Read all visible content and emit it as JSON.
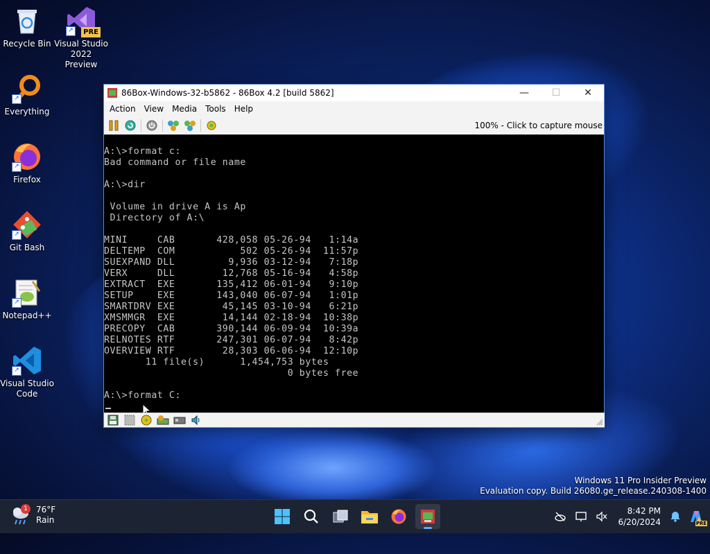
{
  "desktop": {
    "icons": [
      {
        "label": "Recycle Bin"
      },
      {
        "label": "Visual Studio 2022 Preview",
        "badge": "PRE"
      },
      {
        "label": "Everything"
      },
      {
        "label": "Firefox"
      },
      {
        "label": "Git Bash"
      },
      {
        "label": "Notepad++"
      },
      {
        "label": "Visual Studio Code"
      }
    ]
  },
  "window": {
    "title": "86Box-Windows-32-b5862 - 86Box 4.2 [build 5862]",
    "menu": [
      "Action",
      "View",
      "Media",
      "Tools",
      "Help"
    ],
    "capture_hint": "100% - Click to capture mouse",
    "screen_text": "A:\\>format c:\nBad command or file name\n\nA:\\>dir\n\n Volume in drive A is Ap\n Directory of A:\\\n\nMINI     CAB       428,058 05-26-94   1:14a\nDELTEMP  COM           502 05-26-94  11:57p\nSUEXPAND DLL         9,936 03-12-94   7:18p\nVERX     DLL        12,768 05-16-94   4:58p\nEXTRACT  EXE       135,412 06-01-94   9:10p\nSETUP    EXE       143,040 06-07-94   1:01p\nSMARTDRV EXE        45,145 03-10-94   6:21p\nXMSMMGR  EXE        14,144 02-18-94  10:38p\nPRECOPY  CAB       390,144 06-09-94  10:39a\nRELNOTES RTF       247,301 06-07-94   8:42p\nOVERVIEW RTF        28,303 06-06-94  12:10p\n       11 file(s)      1,454,753 bytes\n                               0 bytes free\n\nA:\\>format C:"
  },
  "watermark": {
    "line1": "Windows 11 Pro Insider Preview",
    "line2": "Evaluation copy. Build 26080.ge_release.240308-1400"
  },
  "taskbar": {
    "weather": {
      "temp": "76°F",
      "condition": "Rain",
      "badge": "1"
    },
    "clock": {
      "time": "8:42 PM",
      "date": "6/20/2024"
    },
    "copilot_badge": "PRE"
  },
  "colors": {
    "accent": "#5da8ff",
    "terminal_fg": "#c6c6c6",
    "taskbar_bg": "#1c2333"
  }
}
